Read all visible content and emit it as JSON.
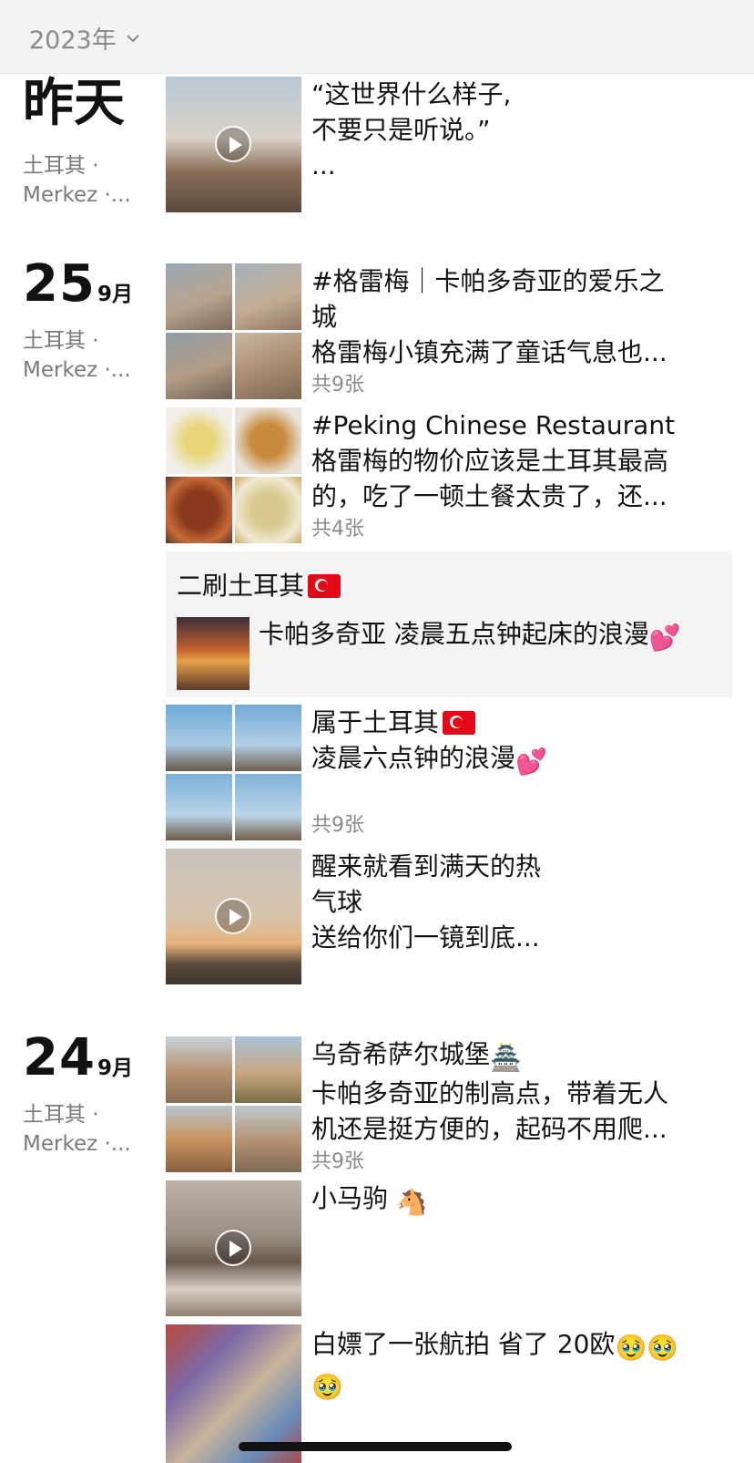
{
  "header": {
    "year": "2023年"
  },
  "days": [
    {
      "day": "昨天",
      "month": "",
      "location_line1": "土耳其 ·",
      "location_line2": "Merkez ·...",
      "posts": [
        {
          "lines": [
            "“这世界什么样子,",
            "不要只是听说。”",
            "..."
          ],
          "count": "",
          "video": true
        }
      ]
    },
    {
      "day": "25",
      "month": "9月",
      "location_line1": "土耳其 ·",
      "location_line2": "Merkez ·...",
      "posts": [
        {
          "lines": [
            "#格雷梅｜卡帕多奇亚的爱乐之",
            "城",
            "格雷梅小镇充满了童话气息也..."
          ],
          "count": "共9张"
        },
        {
          "lines": [
            "#Peking Chinese Restaurant",
            "格雷梅的物价应该是土耳其最高",
            "的，吃了一顿土餐太贵了，还..."
          ],
          "count": "共4张"
        },
        {
          "share_title": "二刷土耳其",
          "share_text": "卡帕多奇亚 凌晨五点钟起床的浪漫"
        },
        {
          "lines": [
            "属于土耳其",
            "凌晨六点钟的浪漫"
          ],
          "count": "共9张"
        },
        {
          "lines": [
            "醒来就看到满天的热",
            "气球",
            "送给你们一镜到底..."
          ],
          "count": "",
          "video": true
        }
      ]
    },
    {
      "day": "24",
      "month": "9月",
      "location_line1": "土耳其 ·",
      "location_line2": "Merkez ·...",
      "posts": [
        {
          "lines": [
            "乌奇希萨尔城堡",
            "卡帕多奇亚的制高点，带着无人",
            "机还是挺方便的，起码不用爬..."
          ],
          "count": "共9张"
        },
        {
          "lines": [
            "小马驹"
          ],
          "count": "",
          "video": true
        },
        {
          "lines": [
            "白嫖了一张航拍 省了 20欧"
          ],
          "count": ""
        }
      ]
    }
  ]
}
